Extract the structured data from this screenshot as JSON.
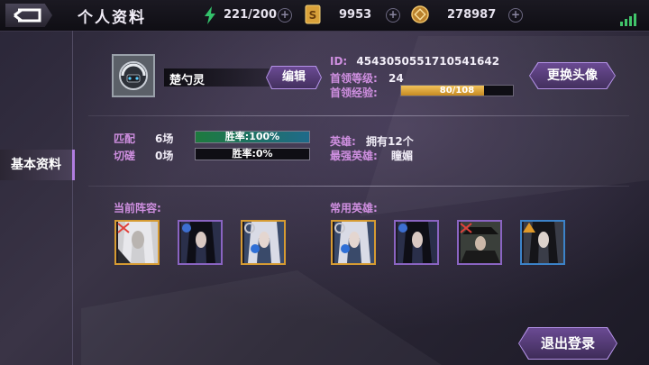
{
  "header": {
    "title": "个人资料",
    "energy": "221/200",
    "coins": "9953",
    "gold": "278987",
    "plus_symbol": "+"
  },
  "sidebar": {
    "active_tab": "基本资料"
  },
  "profile": {
    "name": "楚勺灵",
    "edit_label": "编辑",
    "id_label": "ID:",
    "id_value": "4543050551710541642",
    "level_label": "首领等级:",
    "level_value": "24",
    "exp_label": "首领经验:",
    "exp_value": "80/108",
    "exp_fraction": 0.74,
    "change_avatar_label": "更换头像"
  },
  "stats": {
    "match_label": "匹配",
    "match_count": "6场",
    "match_rate": "胜率:100%",
    "match_rate_fraction": 1.0,
    "spar_label": "切磋",
    "spar_count": "0场",
    "spar_rate": "胜率:0%",
    "spar_rate_fraction": 0.0,
    "heroes_label": "英雄:",
    "heroes_value": "拥有12个",
    "strongest_label": "最强英雄:",
    "strongest_value": "瞳媚"
  },
  "lineup": {
    "current_label": "当前阵容:",
    "frequent_label": "常用英雄:"
  },
  "logout_label": "退出登录",
  "colors": {
    "accent_purple": "#b391e6",
    "label_pink": "#cf8fe0",
    "exp_gold": "#e0a83a",
    "signal_green": "#41c46a"
  }
}
